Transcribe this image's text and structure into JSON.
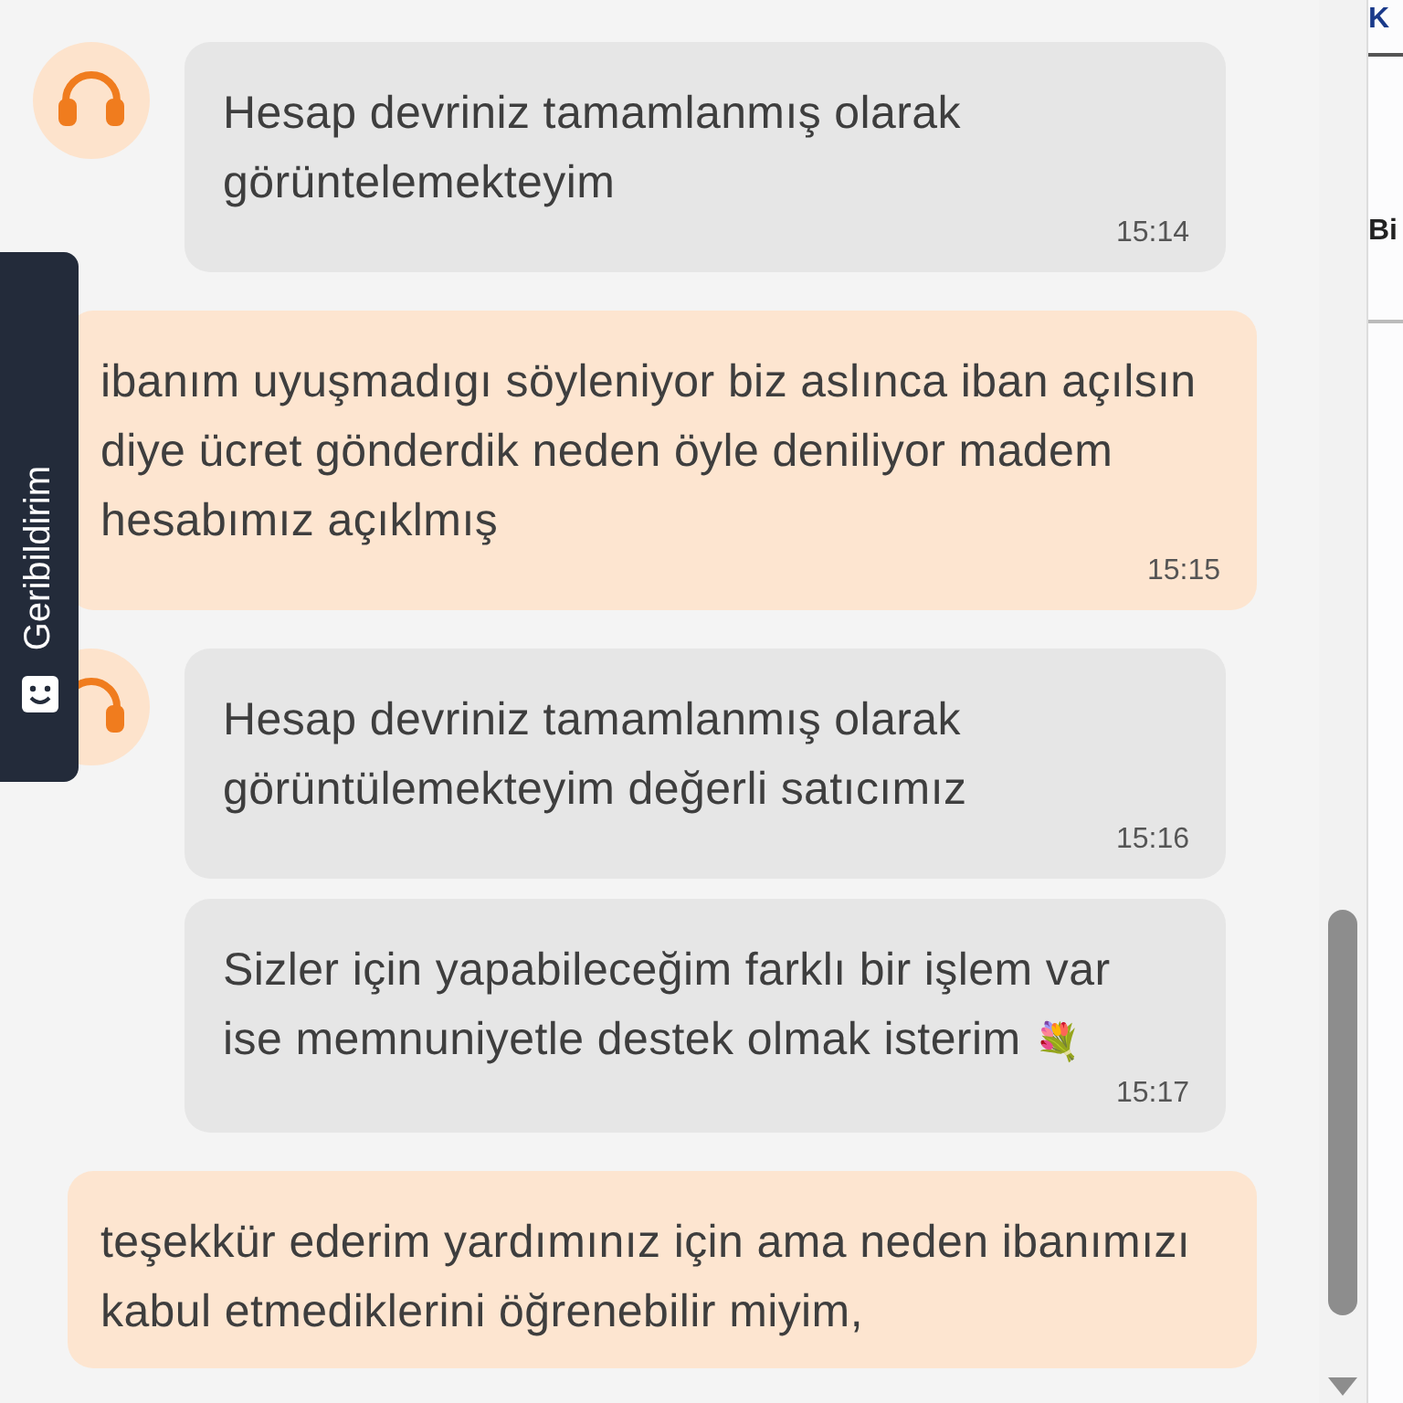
{
  "feedback_tab": {
    "label": "Geribildirim"
  },
  "messages": [
    {
      "kind": "agent",
      "avatar": true,
      "lines": [
        "Hesap devriniz tamamlanmış olarak",
        "görüntelemekteyim"
      ],
      "time": "15:14"
    },
    {
      "kind": "user",
      "lines": [
        "ibanım uyuşmadıgı söyleniyor biz aslınca iban açılsın",
        "diye ücret gönderdik neden öyle deniliyor madem",
        "hesabımız açıklmış"
      ],
      "time": "15:15"
    },
    {
      "kind": "agent",
      "avatar": true,
      "lines": [
        "Hesap devriniz tamamlanmış olarak",
        "görüntülemekteyim değerli satıcımız"
      ],
      "time": "15:16"
    },
    {
      "kind": "agent",
      "avatar": false,
      "lines": [
        "Sizler için yapabileceğim farklı bir işlem var",
        "ise memnuniyetle destek olmak isterim"
      ],
      "emoji": "💐",
      "time": "15:17"
    },
    {
      "kind": "user",
      "lines": [
        "teşekkür ederim yardımınız için ama neden ibanımızı",
        "kabul etmediklerini öğrenebilir miyim,"
      ]
    }
  ],
  "side_panel": {
    "items": [
      {
        "label": "K",
        "kind": "link"
      },
      {
        "label": "Bi",
        "kind": "heading"
      }
    ]
  }
}
